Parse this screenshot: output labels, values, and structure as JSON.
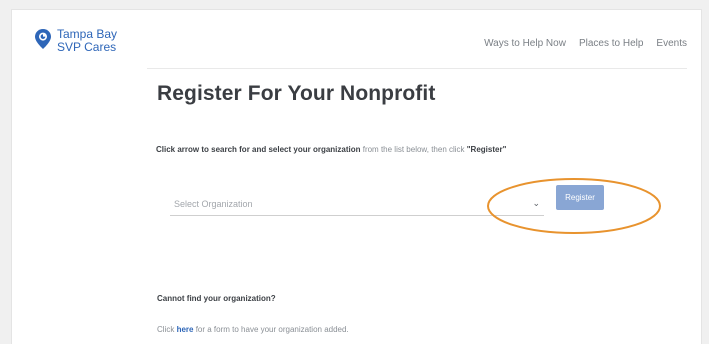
{
  "header": {
    "logo_line1": "Tampa Bay",
    "logo_line2": "SVP Cares",
    "nav": [
      "Ways to Help Now",
      "Places to Help",
      "Events"
    ]
  },
  "main": {
    "title": "Register For Your Nonprofit",
    "instruction_bold": "Click arrow to search for and select your organization",
    "instruction_rest": " from the list below, then click ",
    "instruction_register": "\"Register\"",
    "select_placeholder": "Select Organization",
    "register_label": "Register",
    "cannot_find": "Cannot find your organization?",
    "click_prefix": "Click ",
    "here_link": "here",
    "click_suffix": " for a form to have your organization added."
  },
  "colors": {
    "brand": "#2e66b8",
    "button": "#89a6d4",
    "highlight_ring": "#e8932e"
  },
  "icons": {
    "logo": "map-pin-icon",
    "dropdown": "chevron-down-icon"
  }
}
